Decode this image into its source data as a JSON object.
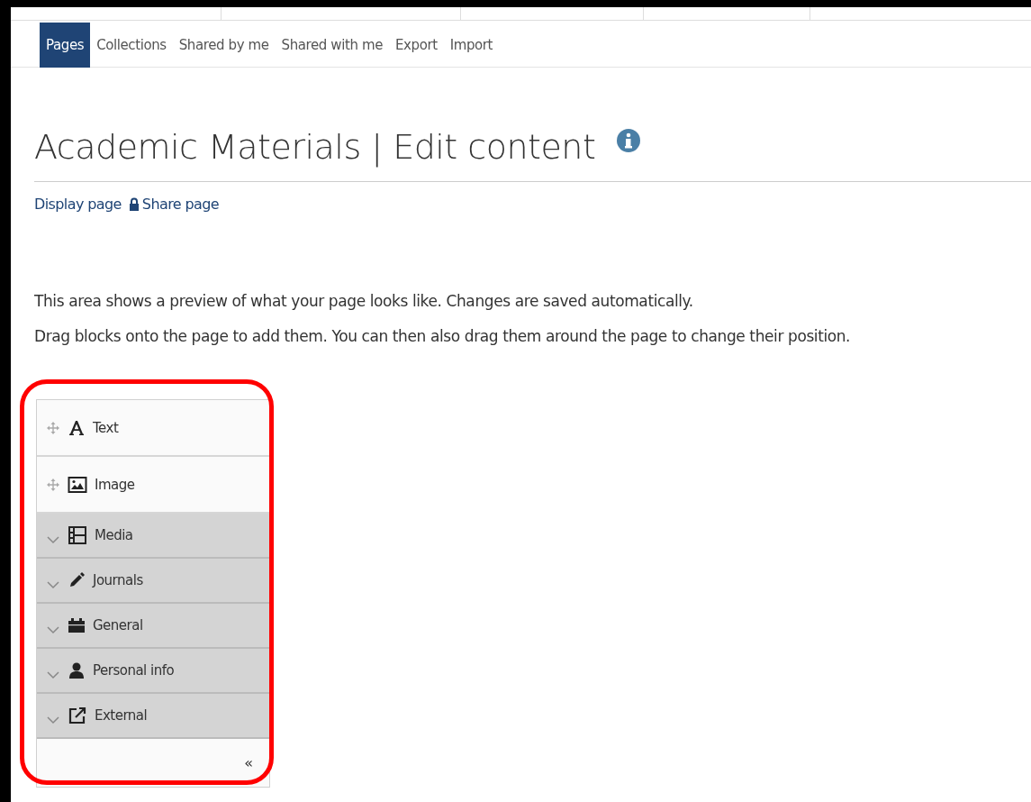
{
  "nav": {
    "tabs": [
      {
        "label": "Pages",
        "selected": true
      },
      {
        "label": "Collections",
        "selected": false
      },
      {
        "label": "Shared by me",
        "selected": false
      },
      {
        "label": "Shared with me",
        "selected": false
      },
      {
        "label": "Export",
        "selected": false
      },
      {
        "label": "Import",
        "selected": false
      }
    ]
  },
  "page": {
    "title": "Academic Materials | Edit content",
    "links": [
      "Display page",
      "Share page"
    ],
    "paragraphs": [
      "This area shows a preview of what your page looks like. Changes are saved automatically.",
      "Drag blocks onto the page to add them. You can then also drag them around the page to change their position."
    ]
  },
  "blocks": {
    "items": [
      {
        "kind": "block",
        "label": "Text"
      },
      {
        "kind": "block",
        "label": "Image"
      },
      {
        "kind": "category",
        "label": "Media",
        "expanded": false
      },
      {
        "kind": "category",
        "label": "Journals",
        "expanded": false
      },
      {
        "kind": "category",
        "label": "General",
        "expanded": false
      },
      {
        "kind": "category",
        "label": "Personal info",
        "expanded": false
      },
      {
        "kind": "category",
        "label": "External",
        "expanded": false
      }
    ],
    "collapse": "«"
  }
}
